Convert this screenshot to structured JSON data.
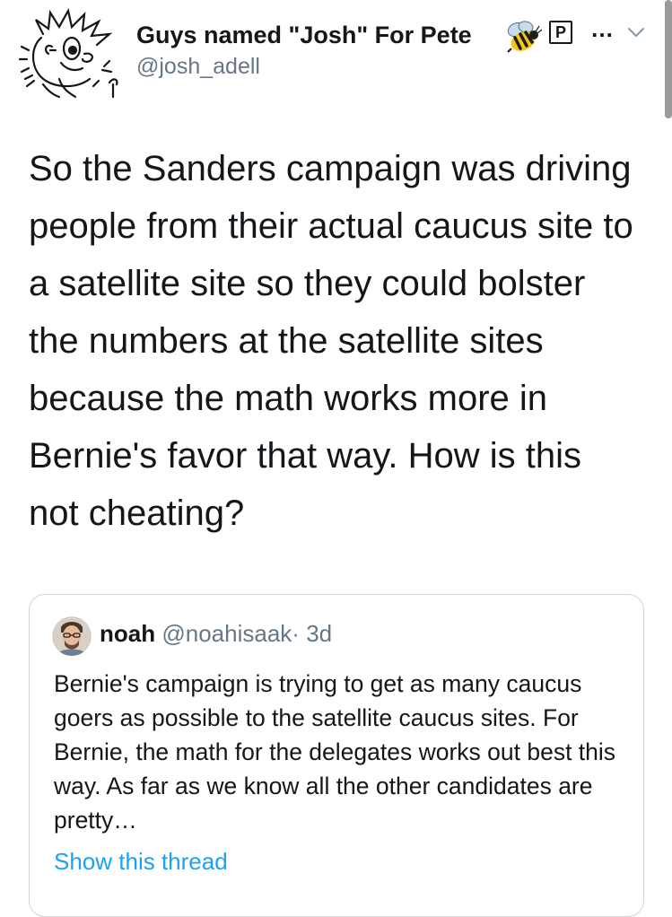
{
  "author": {
    "name": "Guys named \"Josh\" For Pete",
    "handle": "@josh_adell",
    "badge": "P"
  },
  "tweet": {
    "text": "So the Sanders campaign was driving people from their actual caucus site to a satellite site so they could bolster the numbers at the satellite sites because the math works more in Bernie's favor that way. How is this not cheating?"
  },
  "quote": {
    "name": "noah",
    "handle": "@noahisaak",
    "separator": "·",
    "time": "3d",
    "text": "Bernie's campaign is trying to get as many caucus goers as possible to the satellite caucus sites. For Bernie, the math for the delegates works out best this way. As far as we know all the other candidates are pretty…",
    "show_thread": "Show this thread"
  },
  "icons": {
    "avatar": "cartoon-character-avatar",
    "bee": "bee-emoji-icon",
    "more": "more-dots-icon",
    "chevron": "chevron-down-icon"
  },
  "colors": {
    "text": "#14171a",
    "secondary": "#657786",
    "link": "#1da1f2",
    "border": "#ccd6dd"
  }
}
